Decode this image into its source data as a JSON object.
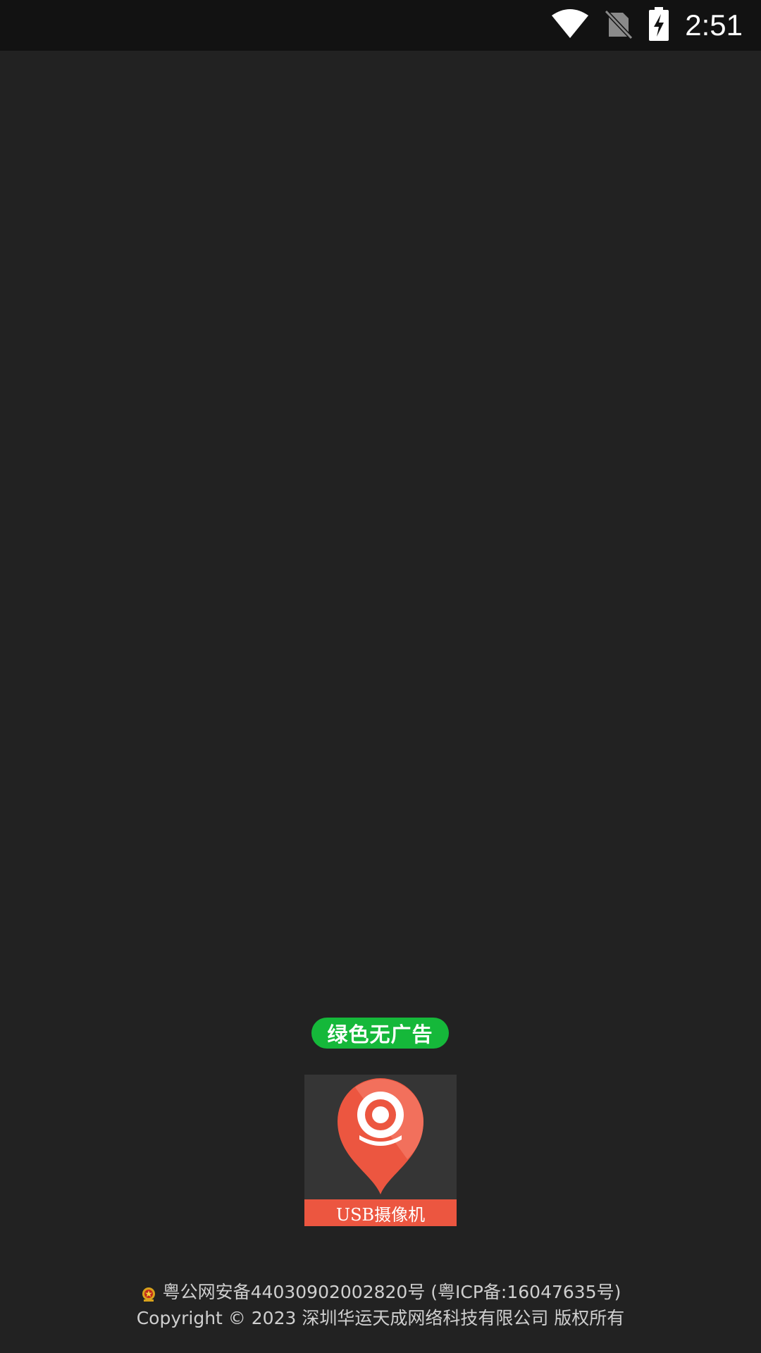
{
  "status_bar": {
    "time": "2:51",
    "icons": [
      "wifi-icon",
      "no-sim-icon",
      "battery-charging-icon"
    ]
  },
  "splash": {
    "badge_text": "绿色无广告",
    "app_label": "USB摄像机",
    "colors": {
      "background": "#222222",
      "badge": "#15b83a",
      "logo_red": "#ec5640",
      "logo_tile": "#353535"
    }
  },
  "footer": {
    "police_record": "粤公网安备44030902002820号 (粤ICP备:16047635号)",
    "copyright": "Copyright © 2023 深圳华运天成网络科技有限公司 版权所有"
  }
}
